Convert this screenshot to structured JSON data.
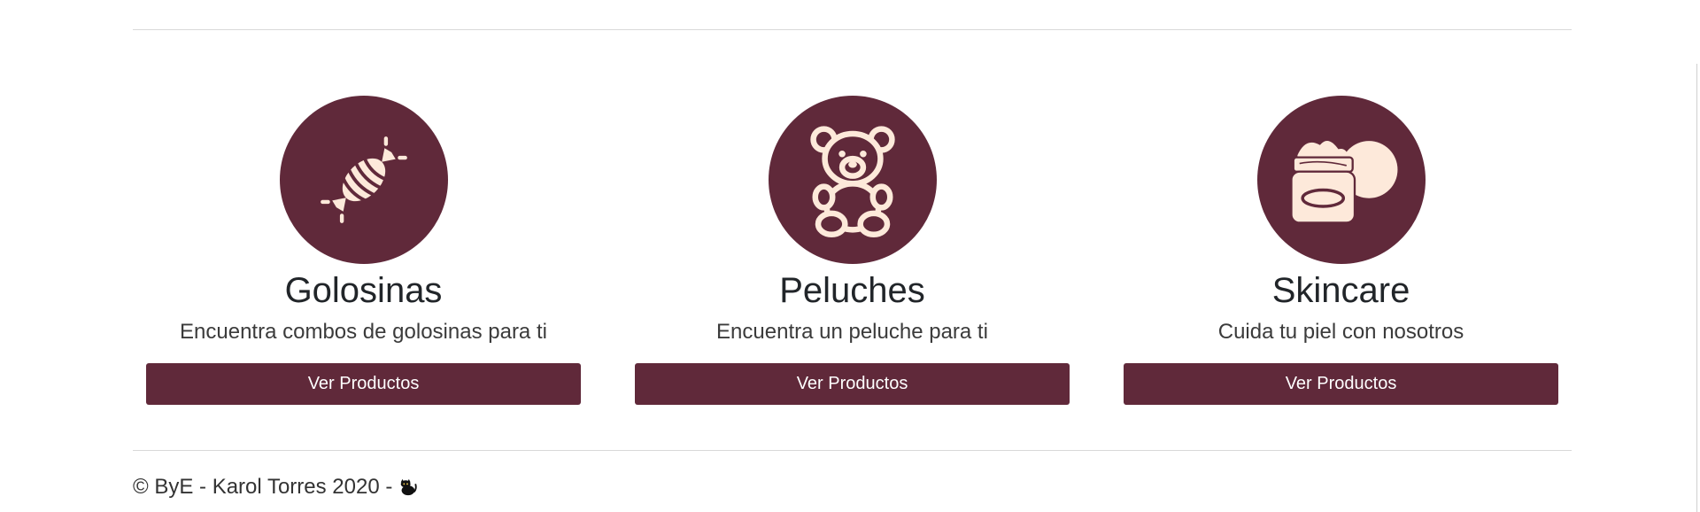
{
  "colors": {
    "accent": "#60293a",
    "icon_fill": "#fde9da",
    "text": "#212529",
    "divider": "#d9d9d9"
  },
  "cards": [
    {
      "icon": "candy-icon",
      "title": "Golosinas",
      "description": "Encuentra combos de golosinas para ti",
      "button_label": "Ver Productos"
    },
    {
      "icon": "teddy-bear-icon",
      "title": "Peluches",
      "description": "Encuentra un peluche para ti",
      "button_label": "Ver Productos"
    },
    {
      "icon": "skincare-jar-icon",
      "title": "Skincare",
      "description": "Cuida tu piel con nosotros",
      "button_label": "Ver Productos"
    }
  ],
  "footer": {
    "text": "© ByE - Karol Torres 2020 -",
    "icon": "black-cat-icon"
  }
}
